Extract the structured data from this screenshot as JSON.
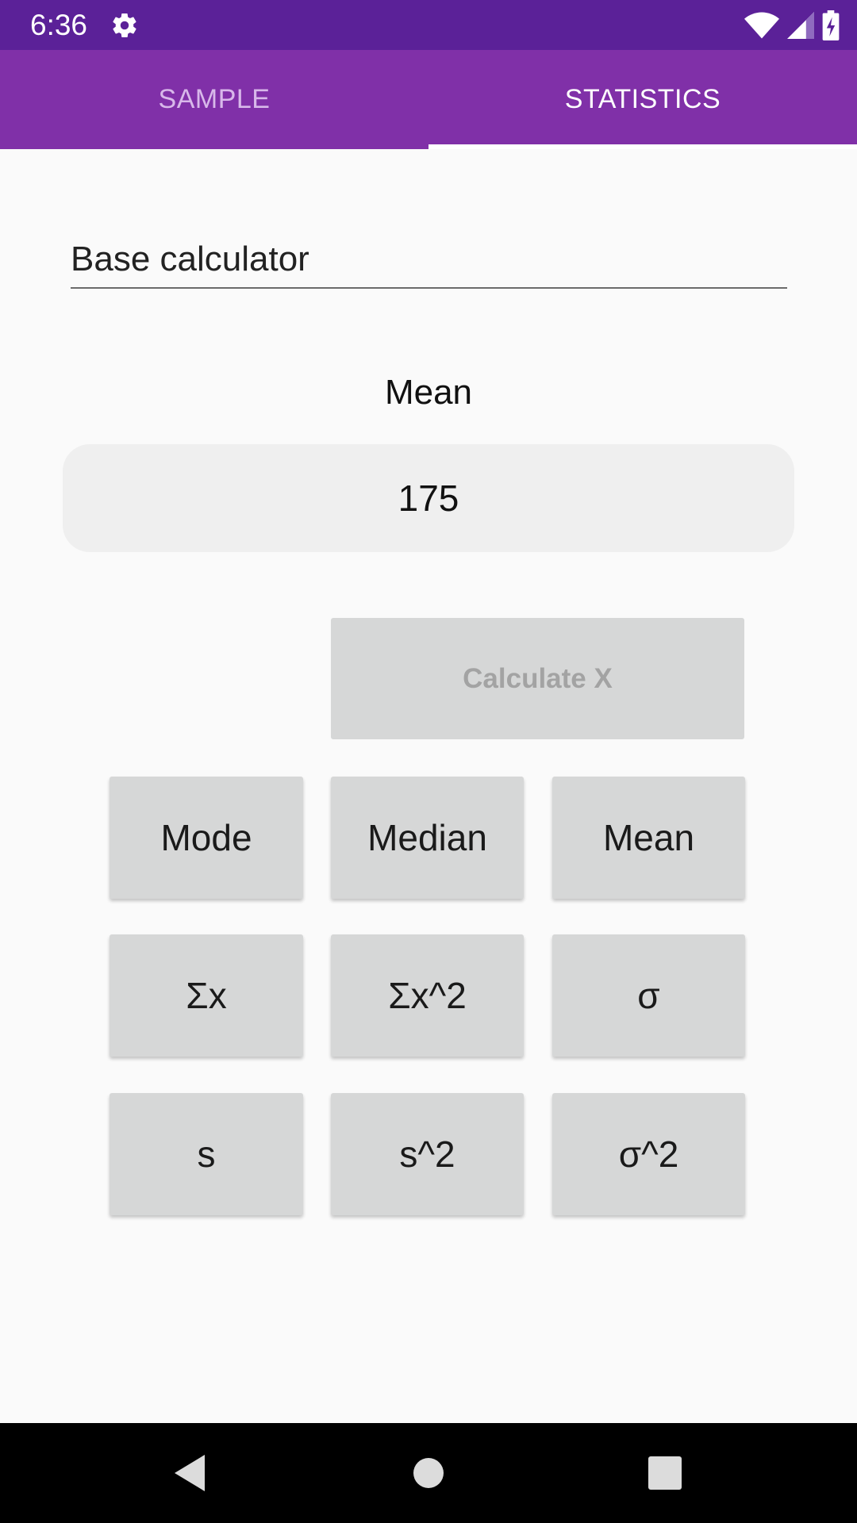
{
  "status_bar": {
    "time": "6:36"
  },
  "tabs": [
    {
      "label": "SAMPLE",
      "active": false
    },
    {
      "label": "STATISTICS",
      "active": true
    }
  ],
  "base_input": {
    "value": "Base calculator"
  },
  "result": {
    "label": "Mean",
    "value": "175"
  },
  "calculate_button": {
    "label": "Calculate X",
    "enabled": false
  },
  "buttons": {
    "mode": "Mode",
    "median": "Median",
    "mean": "Mean",
    "sum_x": "Σx",
    "sum_x2": "Σx^2",
    "sigma": "σ",
    "s": "s",
    "s2": "s^2",
    "sigma2": "σ^2"
  },
  "colors": {
    "status_bar": "#5b2198",
    "tab_bar": "#8030a8",
    "button": "#d6d7d7",
    "result_box": "#efefef"
  }
}
